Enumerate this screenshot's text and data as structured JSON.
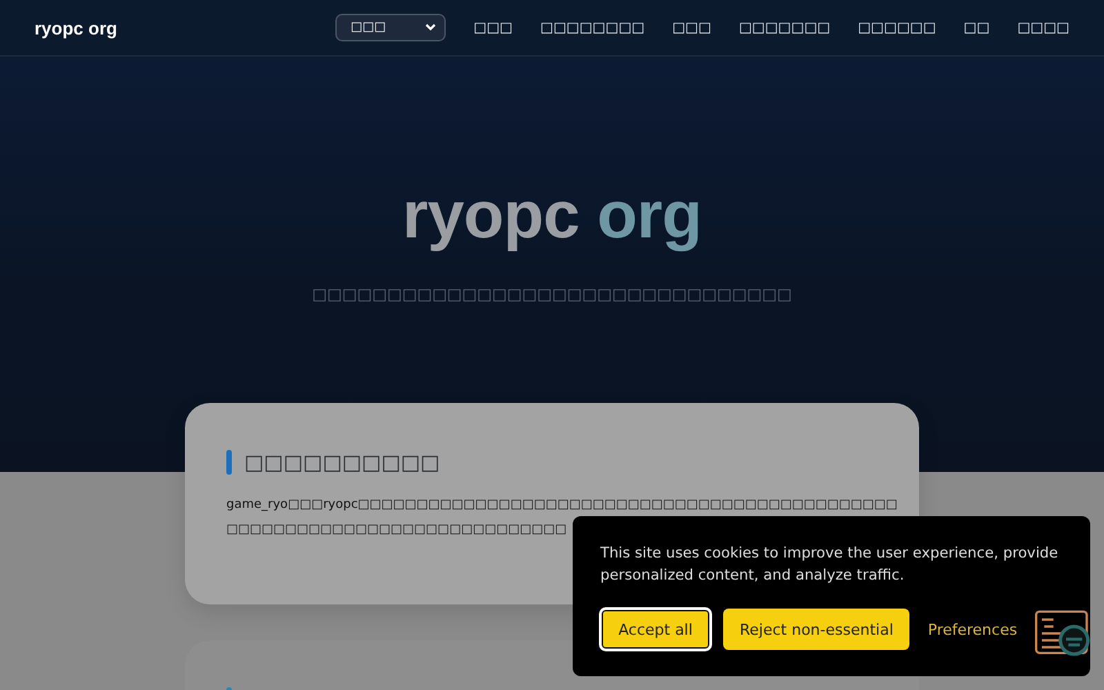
{
  "header": {
    "logo": "ryopc org",
    "language_select": {
      "value": "□□□"
    },
    "nav": [
      "□□□",
      "□□□□□□□□",
      "□□□",
      "□□□□□□□",
      "□□□□□□",
      "□□",
      "□□□□"
    ]
  },
  "hero": {
    "title_part1": "ryopc",
    "title_part2": "org",
    "subtitle": "□□□□□□□□□□□□□□□□□□□□□□□□□□□□□□□□"
  },
  "card": {
    "heading": "□□□□□□□□□□",
    "lines": [
      "game_ryo□□□ryopc□□□□□□□□□□□□□□□□□□□□□□□□□□□□□□□□□□□□□□□□□□□□□□",
      "□□□□□□□□□□□□□□□□□□□□□□□□□□□□□"
    ]
  },
  "cookie_banner": {
    "message": "This site uses cookies to improve the user experience, provide personalized content, and analyze traffic.",
    "buttons": [
      {
        "label": "Accept all",
        "kind": "focused"
      },
      {
        "label": "Reject non-essential",
        "kind": "solid"
      },
      {
        "label": "Preferences",
        "kind": "link"
      }
    ]
  }
}
